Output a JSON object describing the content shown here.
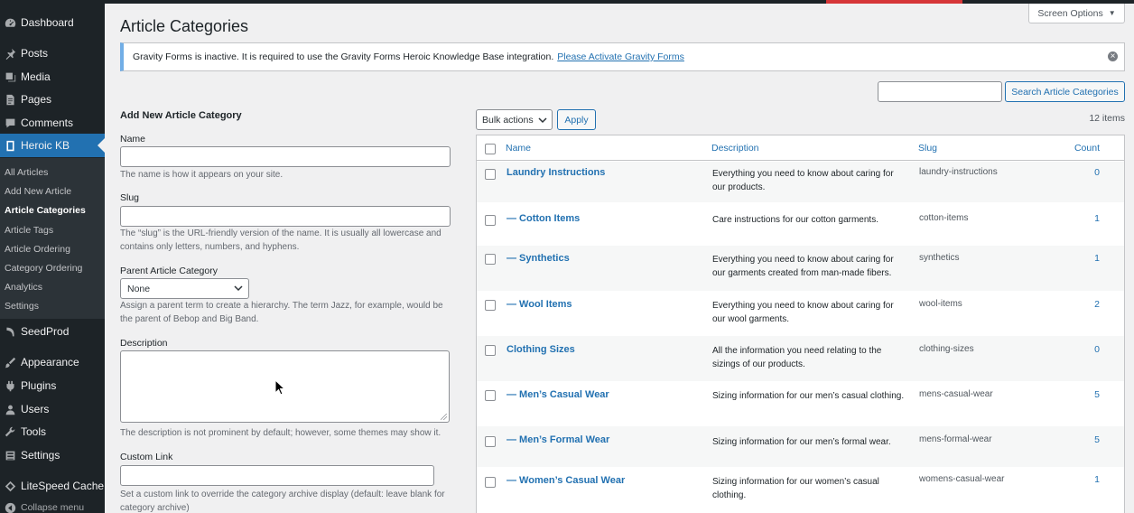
{
  "sidebar": {
    "items": [
      {
        "label": "Dashboard",
        "icon": "dashboard-icon"
      },
      {
        "label": "Posts",
        "icon": "pin-icon"
      },
      {
        "label": "Media",
        "icon": "media-icon"
      },
      {
        "label": "Pages",
        "icon": "pages-icon"
      },
      {
        "label": "Comments",
        "icon": "comment-icon"
      },
      {
        "label": "Heroic KB",
        "icon": "book-icon"
      },
      {
        "label": "SeedProd",
        "icon": "seedprod-icon"
      },
      {
        "label": "Appearance",
        "icon": "brush-icon"
      },
      {
        "label": "Plugins",
        "icon": "plugin-icon"
      },
      {
        "label": "Users",
        "icon": "user-icon"
      },
      {
        "label": "Tools",
        "icon": "wrench-icon"
      },
      {
        "label": "Settings",
        "icon": "settings-icon"
      },
      {
        "label": "LiteSpeed Cache",
        "icon": "litespeed-icon"
      },
      {
        "label": "Collapse menu",
        "icon": "collapse-icon"
      }
    ],
    "submenu": [
      "All Articles",
      "Add New Article",
      "Article Categories",
      "Article Tags",
      "Article Ordering",
      "Category Ordering",
      "Analytics",
      "Settings"
    ]
  },
  "header": {
    "title": "Article Categories",
    "screen_options": "Screen Options"
  },
  "notice": {
    "text": "Gravity Forms is inactive. It is required to use the Gravity Forms Heroic Knowledge Base integration.",
    "link": "Please Activate Gravity Forms"
  },
  "form": {
    "heading": "Add New Article Category",
    "name_label": "Name",
    "name_desc": "The name is how it appears on your site.",
    "slug_label": "Slug",
    "slug_desc": "The “slug” is the URL-friendly version of the name. It is usually all lowercase and contains only letters, numbers, and hyphens.",
    "parent_label": "Parent Article Category",
    "parent_value": "None",
    "parent_desc": "Assign a parent term to create a hierarchy. The term Jazz, for example, would be the parent of Bebop and Big Band.",
    "description_label": "Description",
    "description_desc": "The description is not prominent by default; however, some themes may show it.",
    "custom_link_label": "Custom Link",
    "custom_link_desc": "Set a custom link to override the category archive display (default: leave blank for category archive)"
  },
  "list": {
    "search_button": "Search Article Categories",
    "bulk_actions": "Bulk actions",
    "apply": "Apply",
    "items_count": "12 items",
    "columns": {
      "name": "Name",
      "description": "Description",
      "slug": "Slug",
      "count": "Count"
    },
    "rows": [
      {
        "name": "Laundry Instructions",
        "description": "Everything you need to know about caring for our products.",
        "slug": "laundry-instructions",
        "count": "0"
      },
      {
        "name": "— Cotton Items",
        "description": "Care instructions for our cotton garments.",
        "slug": "cotton-items",
        "count": "1"
      },
      {
        "name": "— Synthetics",
        "description": "Everything you need to know about caring for our garments created from man-made fibers.",
        "slug": "synthetics",
        "count": "1"
      },
      {
        "name": "— Wool Items",
        "description": "Everything you need to know about caring for our wool garments.",
        "slug": "wool-items",
        "count": "2"
      },
      {
        "name": "Clothing Sizes",
        "description": "All the information you need relating to the sizings of our products.",
        "slug": "clothing-sizes",
        "count": "0"
      },
      {
        "name": "— Men’s Casual Wear",
        "description": "Sizing information for our men’s casual clothing.",
        "slug": "mens-casual-wear",
        "count": "5"
      },
      {
        "name": "— Men’s Formal Wear",
        "description": "Sizing information for our men’s formal wear.",
        "slug": "mens-formal-wear",
        "count": "5"
      },
      {
        "name": "— Women’s Casual Wear",
        "description": "Sizing information for our women’s casual clothing.",
        "slug": "womens-casual-wear",
        "count": "1"
      }
    ]
  },
  "colors": {
    "sidebar_bg": "#1d2327",
    "active": "#2271b1",
    "link": "#2271b1",
    "accent_bar": "#d63638"
  }
}
